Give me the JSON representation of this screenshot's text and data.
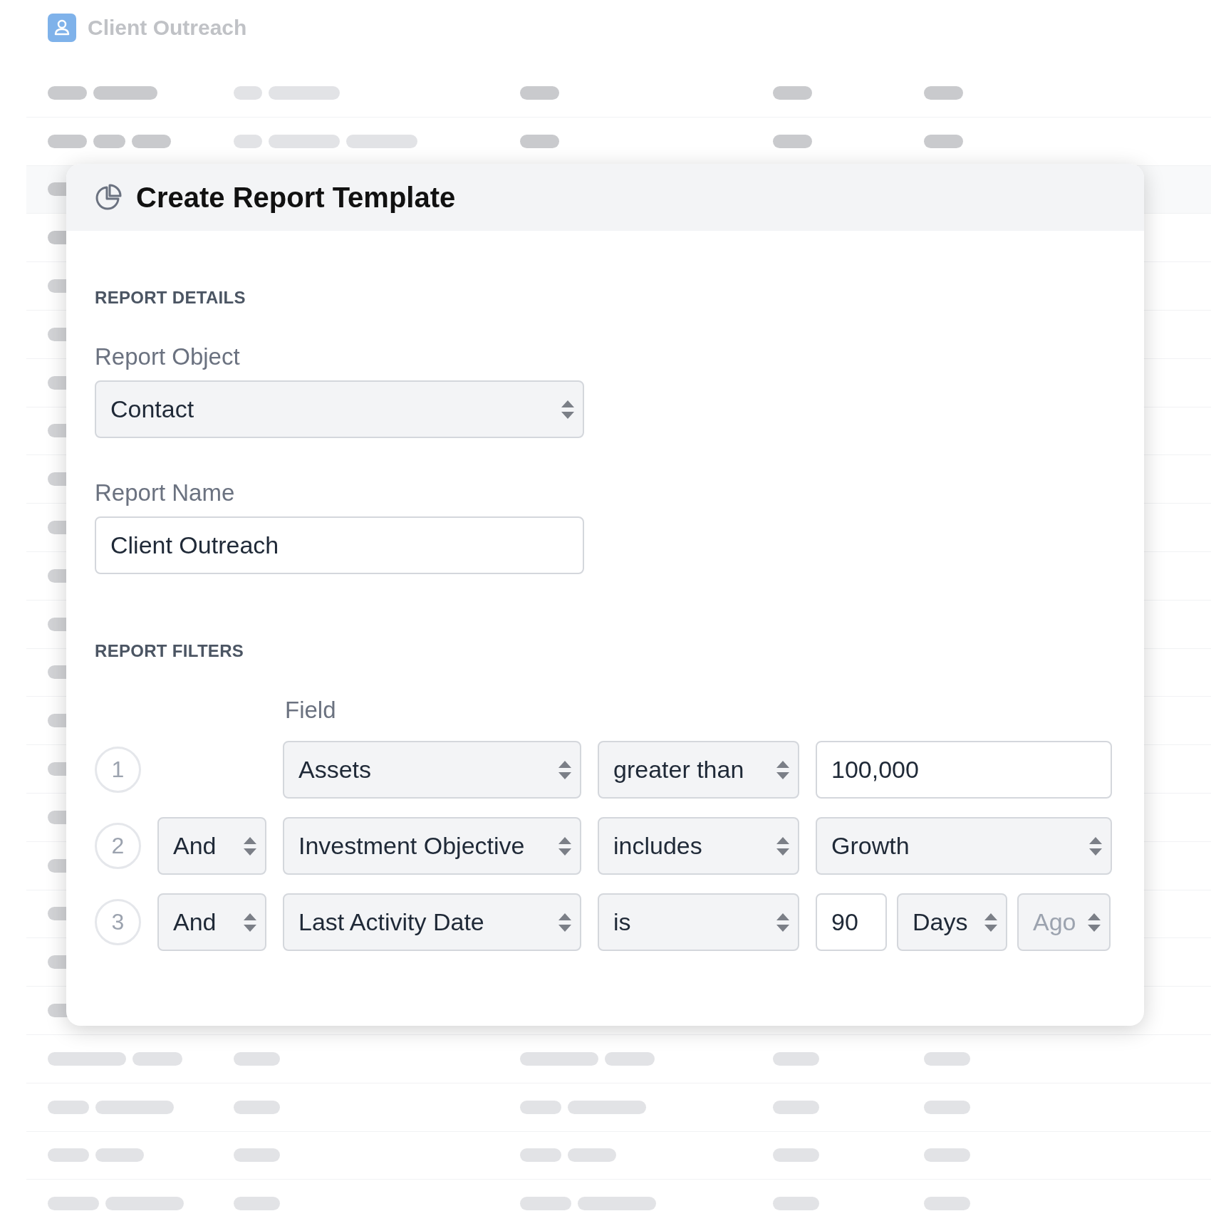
{
  "app": {
    "title": "Client Outreach"
  },
  "dialog": {
    "title": "Create Report Template",
    "details": {
      "heading": "REPORT DETAILS",
      "object": {
        "label": "Report Object",
        "value": "Contact"
      },
      "name": {
        "label": "Report Name",
        "value": "Client Outreach"
      }
    },
    "filters": {
      "heading": "REPORT FILTERS",
      "field_header": "Field",
      "rows": [
        {
          "number": "1",
          "field": "Assets",
          "operator": "greater than",
          "value": {
            "kind": "text",
            "text": "100,000"
          }
        },
        {
          "number": "2",
          "conjunction": "And",
          "field": "Investment Objective",
          "operator": "includes",
          "value": {
            "kind": "select",
            "text": "Growth"
          }
        },
        {
          "number": "3",
          "conjunction": "And",
          "field": "Last Activity Date",
          "operator": "is",
          "value": {
            "kind": "relative",
            "amount": "90",
            "unit": "Days",
            "direction": {
              "text": "Ago",
              "disabled": true
            }
          }
        }
      ]
    }
  }
}
